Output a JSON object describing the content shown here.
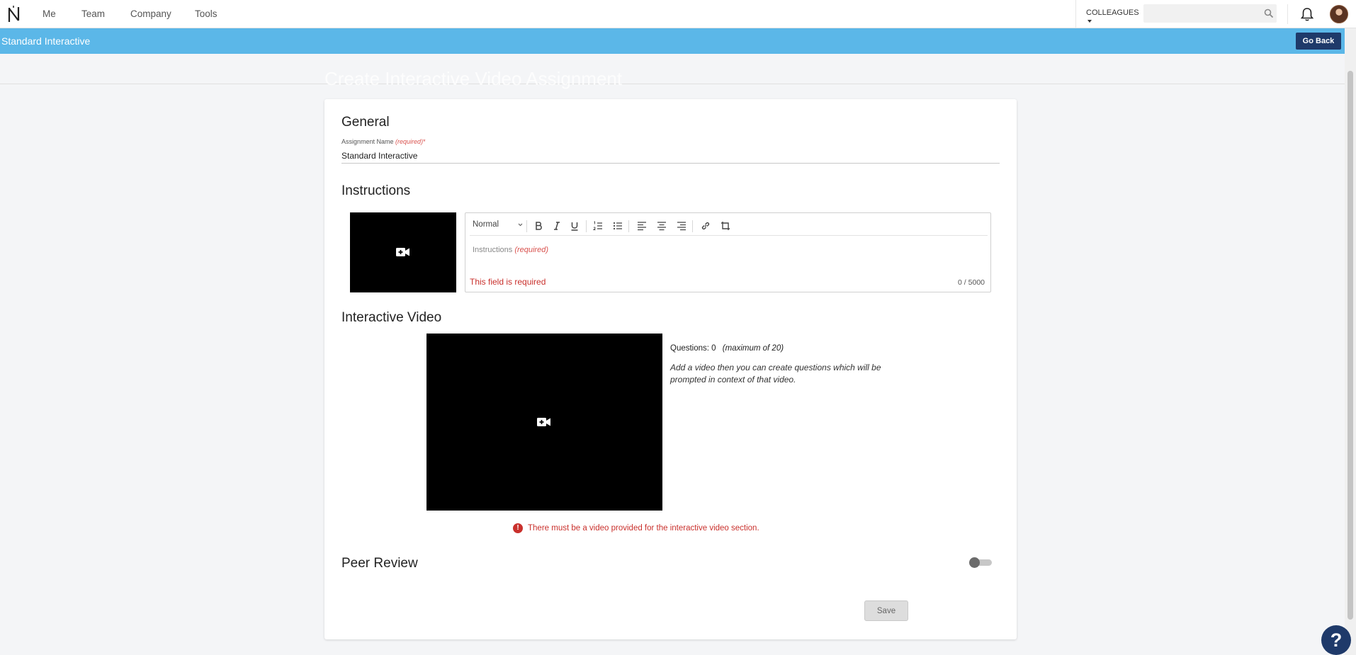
{
  "nav": {
    "links": [
      "Me",
      "Team",
      "Company",
      "Tools"
    ],
    "colleagues_label": "COLLEAGUES",
    "search_placeholder": ""
  },
  "banner": {
    "title": "Standard Interactive",
    "go_back_label": "Go Back"
  },
  "page_title": "Create Interactive Video Assignment",
  "general": {
    "title": "General",
    "assignment_name_label": "Assignment Name",
    "required_tag": "(required)",
    "required_star": "*",
    "assignment_name_value": "Standard Interactive"
  },
  "instructions": {
    "title": "Instructions",
    "format_select": "Normal",
    "placeholder_label": "Instructions",
    "placeholder_required": "(required)",
    "error": "This field is required",
    "char_count": "0 / 5000"
  },
  "interactive_video": {
    "title": "Interactive Video",
    "questions_label": "Questions: 0",
    "questions_max": "(maximum of 20)",
    "help_text": "Add a video then you can create questions which will be prompted in context of that video.",
    "error": "There must be a video provided for the interactive video section."
  },
  "peer_review": {
    "title": "Peer Review",
    "enabled": false
  },
  "save_label": "Save",
  "help_fab": "?",
  "colors": {
    "banner": "#5bb7e8",
    "primary_dark": "#1f3a6a",
    "error": "#c9302c"
  }
}
